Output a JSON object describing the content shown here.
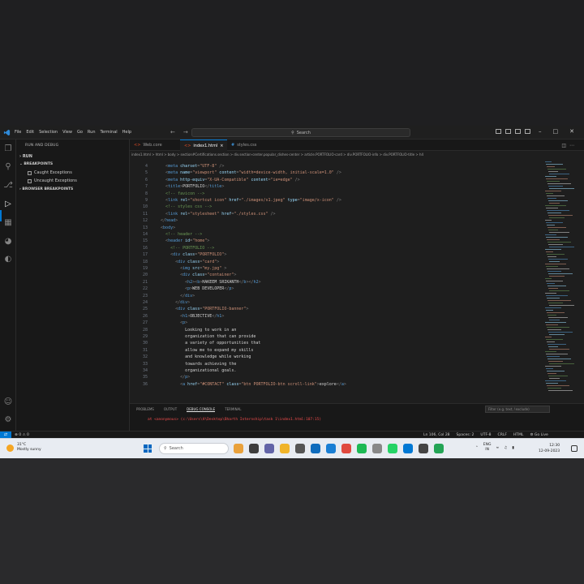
{
  "titlebar": {
    "menu": [
      "File",
      "Edit",
      "Selection",
      "View",
      "Go",
      "Run",
      "Terminal",
      "Help"
    ],
    "search": "Search"
  },
  "sidebar": {
    "title": "RUN AND DEBUG",
    "run_label": "RUN",
    "breakpoints_label": "BREAKPOINTS",
    "caught": "Caught Exceptions",
    "uncaught": "Uncaught Exceptions",
    "browser_bp": "BROWSER BREAKPOINTS"
  },
  "tabs": [
    {
      "label": "Web.core",
      "icon": "html-file-icon"
    },
    {
      "label": "index1.html",
      "icon": "html-file-icon",
      "active": true
    },
    {
      "label": "styles.css",
      "icon": "css-file-icon"
    }
  ],
  "breadcrumb": "index1.html > html > body > section#Certifications.section > div.section-center.popular_dishes-center > article.PORTFOLIO-card > div.PORTFOLIO-info > div.PORTFOLIO-title > h4",
  "code": [
    {
      "n": "4",
      "i": 2,
      "s": [
        [
          "t-pun",
          "<"
        ],
        [
          "t-tag",
          "meta "
        ],
        [
          "t-attr",
          "charset"
        ],
        [
          "t-pun",
          "="
        ],
        [
          "t-str",
          "\"UTF-8\""
        ],
        [
          "t-pun",
          " />"
        ]
      ]
    },
    {
      "n": "5",
      "i": 2,
      "s": [
        [
          "t-pun",
          "<"
        ],
        [
          "t-tag",
          "meta "
        ],
        [
          "t-attr",
          "name"
        ],
        [
          "t-pun",
          "="
        ],
        [
          "t-str",
          "\"viewport\""
        ],
        [
          "t-attr",
          " content"
        ],
        [
          "t-pun",
          "="
        ],
        [
          "t-str",
          "\"width=device-width, initial-scale=1.0\""
        ],
        [
          "t-pun",
          " />"
        ]
      ]
    },
    {
      "n": "6",
      "i": 2,
      "s": [
        [
          "t-pun",
          "<"
        ],
        [
          "t-tag",
          "meta "
        ],
        [
          "t-attr",
          "http-equiv"
        ],
        [
          "t-pun",
          "="
        ],
        [
          "t-str",
          "\"X-UA-Compatible\""
        ],
        [
          "t-attr",
          " content"
        ],
        [
          "t-pun",
          "="
        ],
        [
          "t-str",
          "\"ie=edge\""
        ],
        [
          "t-pun",
          " />"
        ]
      ]
    },
    {
      "n": "7",
      "i": 2,
      "s": [
        [
          "t-pun",
          "<"
        ],
        [
          "t-tag",
          "title"
        ],
        [
          "t-pun",
          ">"
        ],
        [
          "t-txt",
          "PORTFOLIO"
        ],
        [
          "t-pun",
          "</"
        ],
        [
          "t-tag",
          "title"
        ],
        [
          "t-pun",
          ">"
        ]
      ]
    },
    {
      "n": "8",
      "i": 2,
      "s": [
        [
          "t-com",
          "<!-- favicon -->"
        ]
      ]
    },
    {
      "n": "9",
      "i": 2,
      "s": [
        [
          "t-pun",
          "<"
        ],
        [
          "t-tag",
          "link "
        ],
        [
          "t-attr",
          "rel"
        ],
        [
          "t-pun",
          "="
        ],
        [
          "t-str",
          "\"shortcut icon\""
        ],
        [
          "t-attr",
          " href"
        ],
        [
          "t-pun",
          "="
        ],
        [
          "t-str",
          "\"./images/s1.jpeg\""
        ],
        [
          "t-attr",
          " type"
        ],
        [
          "t-pun",
          "="
        ],
        [
          "t-str",
          "\"image/x-icon\""
        ],
        [
          "t-pun",
          " />"
        ]
      ]
    },
    {
      "n": "10",
      "i": 2,
      "s": [
        [
          "t-com",
          "<!-- styles css -->"
        ]
      ]
    },
    {
      "n": "11",
      "i": 2,
      "s": [
        [
          "t-pun",
          "<"
        ],
        [
          "t-tag",
          "link "
        ],
        [
          "t-attr",
          "rel"
        ],
        [
          "t-pun",
          "="
        ],
        [
          "t-str",
          "\"stylesheet\""
        ],
        [
          "t-attr",
          " href"
        ],
        [
          "t-pun",
          "="
        ],
        [
          "t-str",
          "\"./styles.css\""
        ],
        [
          "t-pun",
          " />"
        ]
      ]
    },
    {
      "n": "12",
      "i": 1,
      "s": [
        [
          "t-pun",
          "</"
        ],
        [
          "t-tag",
          "head"
        ],
        [
          "t-pun",
          ">"
        ]
      ]
    },
    {
      "n": "13",
      "i": 1,
      "s": [
        [
          "t-pun",
          "<"
        ],
        [
          "t-tag",
          "body"
        ],
        [
          "t-pun",
          ">"
        ]
      ]
    },
    {
      "n": "14",
      "i": 2,
      "s": [
        [
          "t-com",
          "<!-- header -->"
        ]
      ]
    },
    {
      "n": "15",
      "i": 2,
      "s": [
        [
          "t-pun",
          "<"
        ],
        [
          "t-tag",
          "header "
        ],
        [
          "t-attr",
          "id"
        ],
        [
          "t-pun",
          "="
        ],
        [
          "t-str",
          "\"home\""
        ],
        [
          "t-pun",
          ">"
        ]
      ]
    },
    {
      "n": "16",
      "i": 3,
      "s": [
        [
          "t-com",
          "<!-- PORTFOLIO -->"
        ]
      ]
    },
    {
      "n": "17",
      "i": 3,
      "s": [
        [
          "t-pun",
          "<"
        ],
        [
          "t-tag",
          "div "
        ],
        [
          "t-attr",
          "class"
        ],
        [
          "t-pun",
          "="
        ],
        [
          "t-str",
          "\"PORTFOLIO\""
        ],
        [
          "t-pun",
          ">"
        ]
      ]
    },
    {
      "n": "18",
      "i": 4,
      "s": [
        [
          "t-pun",
          "<"
        ],
        [
          "t-tag",
          "div "
        ],
        [
          "t-attr",
          "class"
        ],
        [
          "t-pun",
          "="
        ],
        [
          "t-str",
          "\"card\""
        ],
        [
          "t-pun",
          ">"
        ]
      ]
    },
    {
      "n": "19",
      "i": 5,
      "s": [
        [
          "t-pun",
          "<"
        ],
        [
          "t-tag",
          "img "
        ],
        [
          "t-attr",
          "src"
        ],
        [
          "t-pun",
          "="
        ],
        [
          "t-str",
          "\"my.jpg\""
        ],
        [
          "t-pun",
          " >"
        ]
      ]
    },
    {
      "n": "20",
      "i": 5,
      "s": [
        [
          "t-pun",
          "<"
        ],
        [
          "t-tag",
          "div "
        ],
        [
          "t-attr",
          "class"
        ],
        [
          "t-pun",
          "="
        ],
        [
          "t-str",
          "\"container\""
        ],
        [
          "t-pun",
          ">"
        ]
      ]
    },
    {
      "n": "21",
      "i": 6,
      "s": [
        [
          "t-pun",
          "<"
        ],
        [
          "t-tag",
          "h2"
        ],
        [
          "t-pun",
          "><"
        ],
        [
          "t-tag",
          "b"
        ],
        [
          "t-pun",
          ">"
        ],
        [
          "t-txt",
          "HAKEEM SRIKANTH"
        ],
        [
          "t-pun",
          "</"
        ],
        [
          "t-tag",
          "b"
        ],
        [
          "t-pun",
          "></"
        ],
        [
          "t-tag",
          "h2"
        ],
        [
          "t-pun",
          ">"
        ]
      ]
    },
    {
      "n": "22",
      "i": 6,
      "s": [
        [
          "t-pun",
          "<"
        ],
        [
          "t-tag",
          "p"
        ],
        [
          "t-pun",
          ">"
        ],
        [
          "t-txt",
          "WEB DEVELOPER"
        ],
        [
          "t-pun",
          "</"
        ],
        [
          "t-tag",
          "p"
        ],
        [
          "t-pun",
          ">"
        ]
      ]
    },
    {
      "n": "23",
      "i": 5,
      "s": [
        [
          "t-pun",
          "</"
        ],
        [
          "t-tag",
          "div"
        ],
        [
          "t-pun",
          ">"
        ]
      ]
    },
    {
      "n": "24",
      "i": 4,
      "s": [
        [
          "t-pun",
          "</"
        ],
        [
          "t-tag",
          "div"
        ],
        [
          "t-pun",
          ">"
        ]
      ]
    },
    {
      "n": "25",
      "i": 4,
      "s": [
        [
          "t-pun",
          "<"
        ],
        [
          "t-tag",
          "div "
        ],
        [
          "t-attr",
          "class"
        ],
        [
          "t-pun",
          "="
        ],
        [
          "t-str",
          "\"PORTFOLIO-banner\""
        ],
        [
          "t-pun",
          ">"
        ]
      ]
    },
    {
      "n": "26",
      "i": 5,
      "s": [
        [
          "t-pun",
          "<"
        ],
        [
          "t-tag",
          "h1"
        ],
        [
          "t-pun",
          ">"
        ],
        [
          "t-txt",
          "OBJECTIVE"
        ],
        [
          "t-pun",
          "</"
        ],
        [
          "t-tag",
          "h1"
        ],
        [
          "t-pun",
          ">"
        ]
      ]
    },
    {
      "n": "27",
      "i": 5,
      "s": [
        [
          "t-pun",
          "<"
        ],
        [
          "t-tag",
          "p"
        ],
        [
          "t-pun",
          ">"
        ]
      ]
    },
    {
      "n": "28",
      "i": 6,
      "s": [
        [
          "t-txt",
          "Looking to work in an"
        ]
      ]
    },
    {
      "n": "29",
      "i": 6,
      "s": [
        [
          "t-txt",
          "organization that can provide"
        ]
      ]
    },
    {
      "n": "30",
      "i": 6,
      "s": [
        [
          "t-txt",
          "a variety of opportunities that"
        ]
      ]
    },
    {
      "n": "31",
      "i": 6,
      "s": [
        [
          "t-txt",
          "allow me to expand my skills"
        ]
      ]
    },
    {
      "n": "32",
      "i": 6,
      "s": [
        [
          "t-txt",
          "and knowledge while working"
        ]
      ]
    },
    {
      "n": "33",
      "i": 6,
      "s": [
        [
          "t-txt",
          "towards achieving the"
        ]
      ]
    },
    {
      "n": "34",
      "i": 6,
      "s": [
        [
          "t-txt",
          "organizational goals."
        ]
      ]
    },
    {
      "n": "35",
      "i": 5,
      "s": [
        [
          "t-pun",
          "</"
        ],
        [
          "t-tag",
          "p"
        ],
        [
          "t-pun",
          ">"
        ]
      ]
    },
    {
      "n": "36",
      "i": 5,
      "s": [
        [
          "t-pun",
          "<"
        ],
        [
          "t-tag",
          "a "
        ],
        [
          "t-attr",
          "href"
        ],
        [
          "t-pun",
          "="
        ],
        [
          "t-str",
          "\"#CONTACT\""
        ],
        [
          "t-attr",
          " class"
        ],
        [
          "t-pun",
          "="
        ],
        [
          "t-str",
          "\"btn PORTFOLIO-btn scroll-link\""
        ],
        [
          "t-pun",
          ">"
        ],
        [
          "t-txt",
          "explore"
        ],
        [
          "t-pun",
          "</"
        ],
        [
          "t-tag",
          "a"
        ],
        [
          "t-pun",
          ">"
        ]
      ]
    }
  ],
  "panel": {
    "tabs": [
      "PROBLEMS",
      "OUTPUT",
      "DEBUG CONSOLE",
      "TERMINAL"
    ],
    "active_tab": "DEBUG CONSOLE",
    "filter_placeholder": "Filter (e.g. text, !exclude)",
    "error_line": "at <anonymous> (c:\\Users\\H\\Desktop\\Bharth Internship\\task 1\\index1.html:107:15)"
  },
  "status": {
    "left": "⊗ 0 ⚠ 0",
    "items": [
      "Ln 106, Col 28",
      "Spaces: 2",
      "UTF-8",
      "CRLF",
      "HTML",
      "⚙ Go Live"
    ]
  },
  "taskbar": {
    "weather_temp": "31°C",
    "weather_desc": "Mostly sunny",
    "search": "Search",
    "lang_top": "ENG",
    "lang_bottom": "IN",
    "time": "12:30",
    "date": "12-09-2023"
  },
  "colors": {
    "accent": "#0078d4",
    "error": "#f14c4c",
    "editor_bg": "#1e1e1e"
  }
}
